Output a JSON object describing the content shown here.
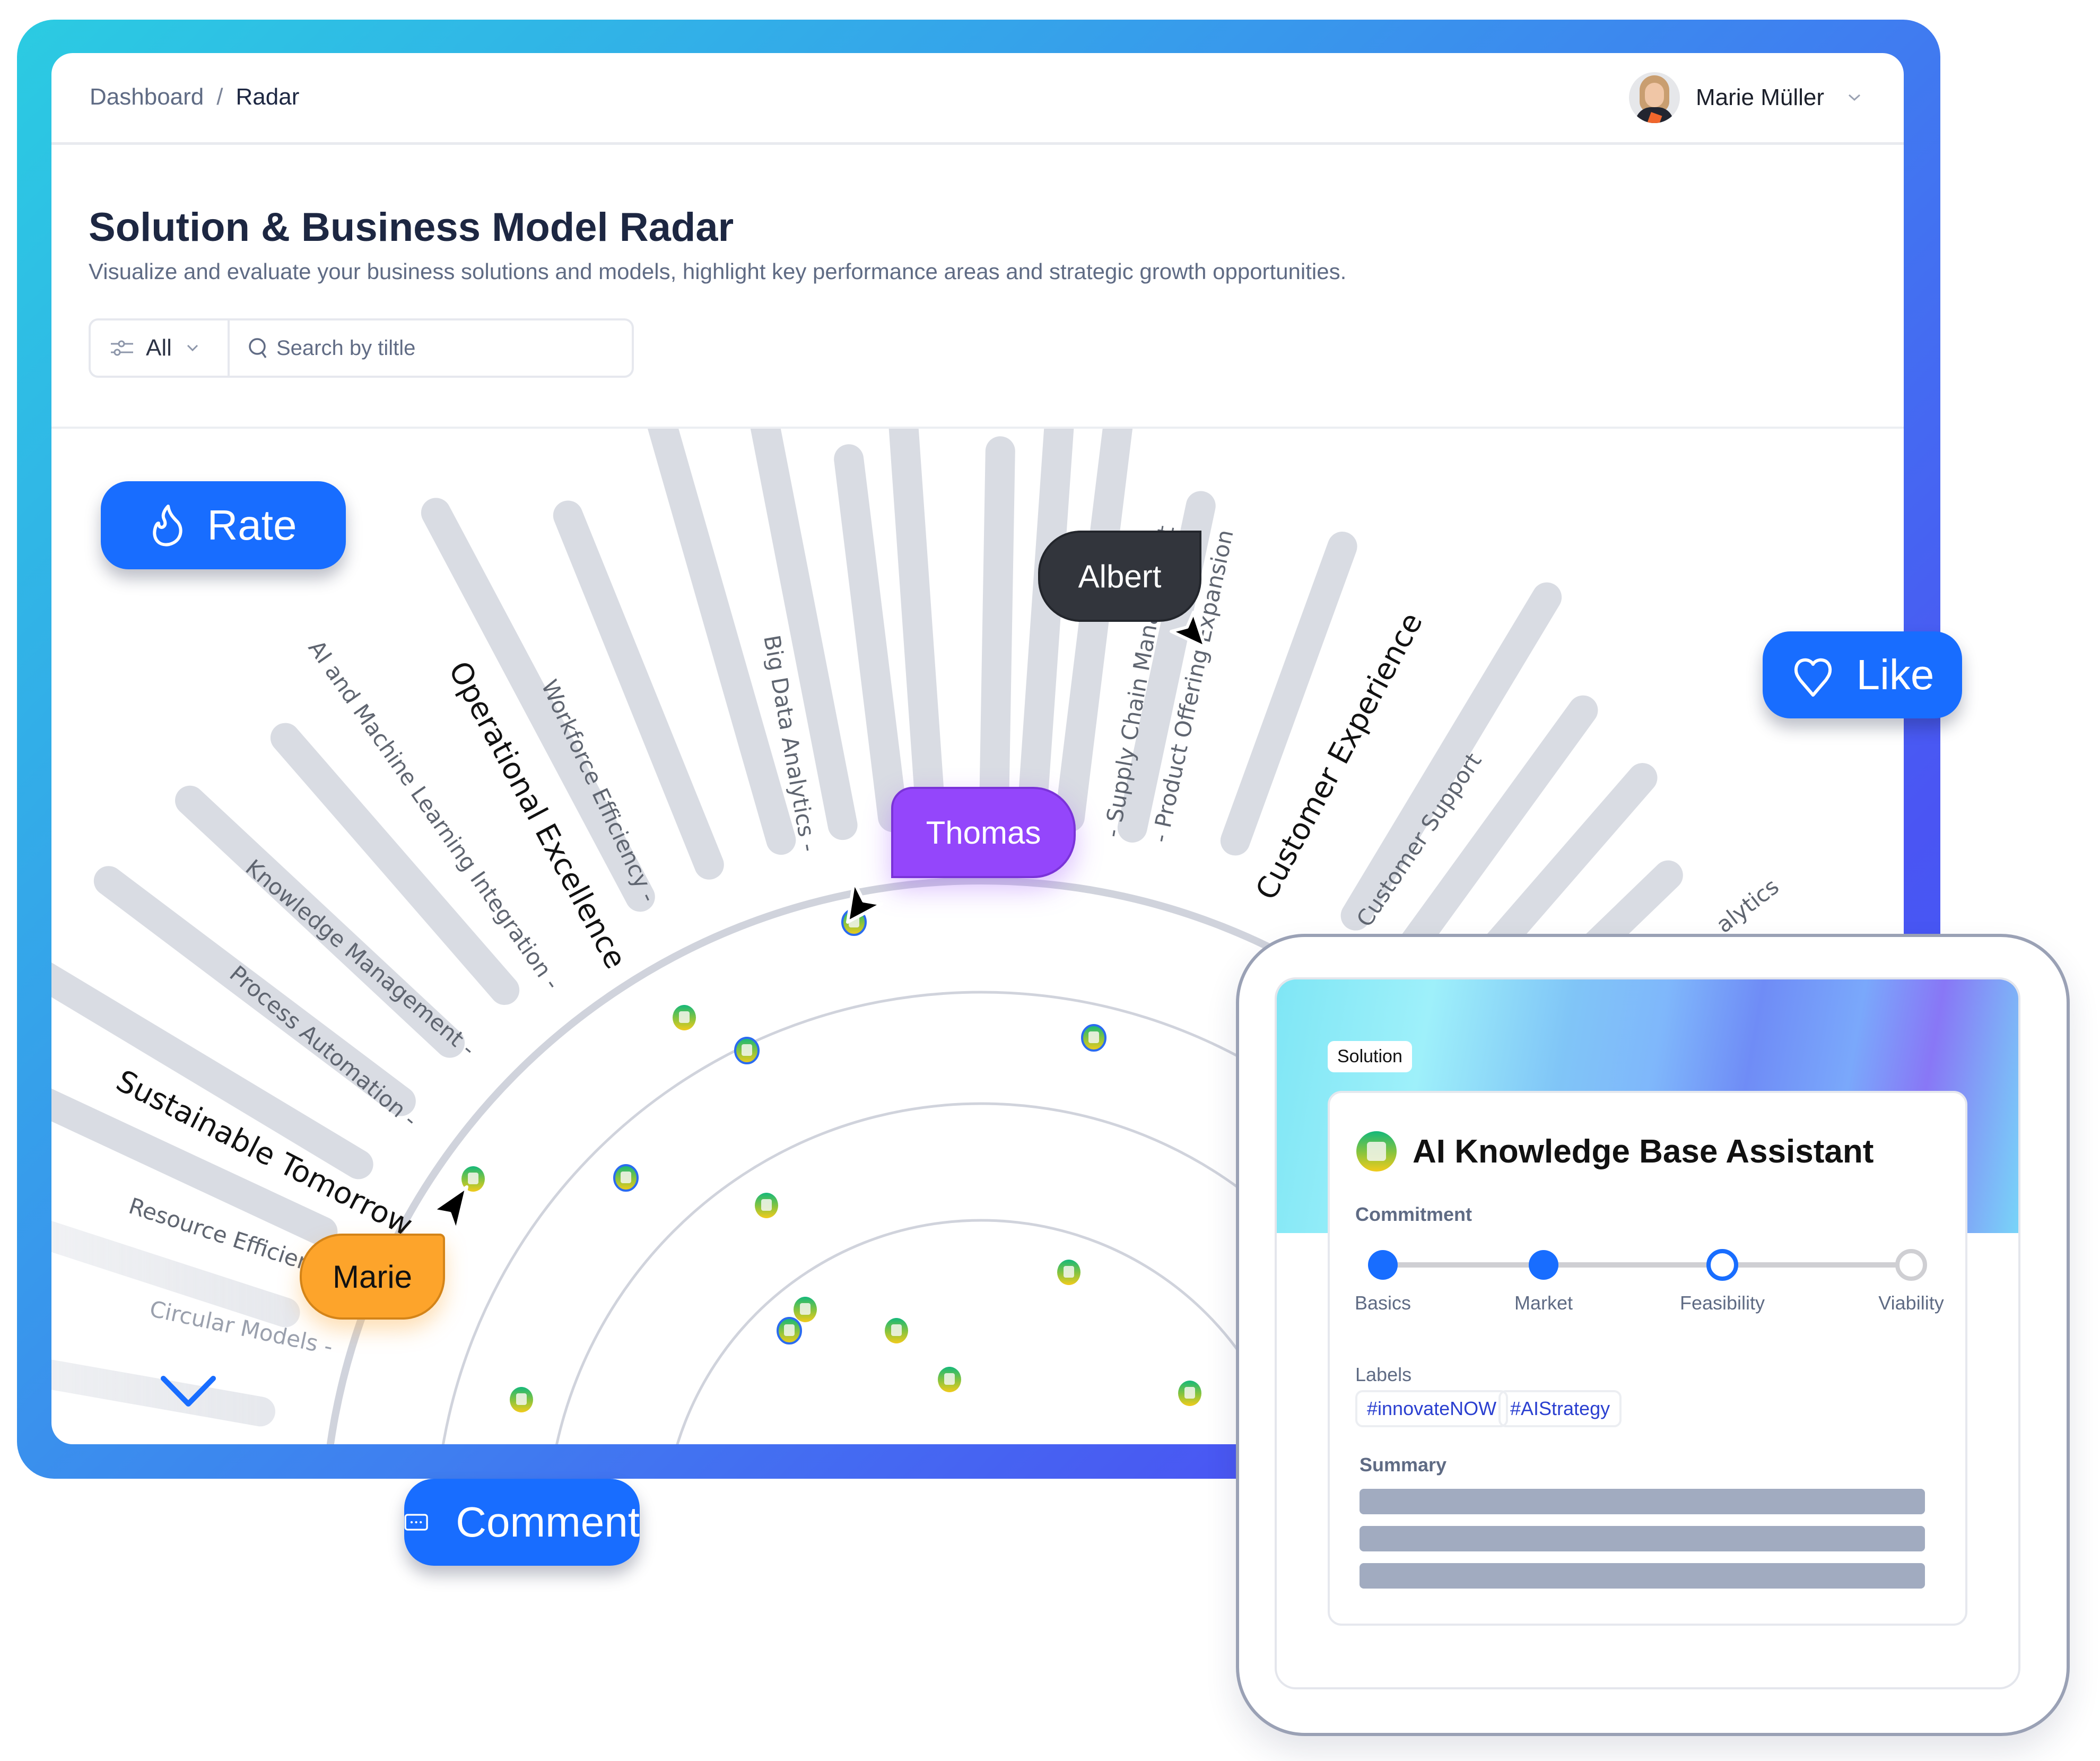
{
  "breadcrumb": {
    "items": [
      "Dashboard",
      "Radar"
    ],
    "separator": "/"
  },
  "user": {
    "name": "Marie Müller",
    "avatar_icon": "user-avatar"
  },
  "page": {
    "title": "Solution & Business Model Radar",
    "subtitle": "Visualize and evaluate your business solutions and models, highlight key performance areas and strategic growth opportunities."
  },
  "filter": {
    "selected": "All",
    "search_placeholder": "Search by tiltle",
    "filter_icon": "sliders-icon",
    "search_icon": "search-icon"
  },
  "actions": {
    "rate": {
      "label": "Rate",
      "icon": "flame-icon"
    },
    "like": {
      "label": "Like",
      "icon": "heart-icon"
    },
    "comment": {
      "label": "Comment",
      "icon": "comment-icon"
    }
  },
  "cursors": [
    {
      "name": "Albert",
      "color": "#32353c"
    },
    {
      "name": "Thomas",
      "color": "#9446fb"
    },
    {
      "name": "Marie",
      "color": "#fda42b"
    }
  ],
  "radar": {
    "categories": [
      {
        "label": "Sustainable Tomorrow",
        "bold": true
      },
      {
        "label": "Resource Efficien",
        "bold": false
      },
      {
        "label": "Circular Models -",
        "bold": false
      },
      {
        "label": "Process Automation -",
        "bold": false
      },
      {
        "label": "Knowledge Management -",
        "bold": false
      },
      {
        "label": "AI and Machine Learning Integration -",
        "bold": false
      },
      {
        "label": "Operational Excellence",
        "bold": true
      },
      {
        "label": "Workforce Efficiency -",
        "bold": false
      },
      {
        "label": "Big Data Analytics -",
        "bold": false
      },
      {
        "label": "- Supply Chain Management",
        "bold": false
      },
      {
        "label": "- Product Offering Expansion",
        "bold": false
      },
      {
        "label": "Customer Experience",
        "bold": true
      },
      {
        "label": "Customer Support",
        "bold": false
      },
      {
        "label": "alytics",
        "bold": false
      }
    ],
    "expand_icon": "chevron-down-icon"
  },
  "detail": {
    "type_chip": "Solution",
    "title": "AI Knowledge Base Assistant",
    "commitment_label": "Commitment",
    "steps": [
      {
        "label": "Basics",
        "state": "done"
      },
      {
        "label": "Market",
        "state": "done"
      },
      {
        "label": "Feasibility",
        "state": "current"
      },
      {
        "label": "Viability",
        "state": "todo"
      }
    ],
    "labels_heading": "Labels",
    "labels": [
      "#innovateNOW",
      "#AIStrategy"
    ],
    "summary_heading": "Summary"
  },
  "colors": {
    "accent": "#186dff",
    "step_done": "#186dff",
    "step_todo": "#cfcfd3",
    "bar": "#d9dce3"
  }
}
